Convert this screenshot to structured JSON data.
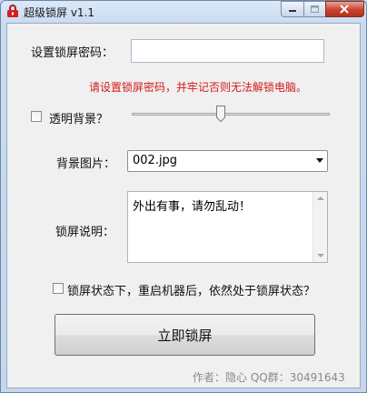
{
  "window": {
    "title": "超级锁屏 v1.1"
  },
  "form": {
    "password_label": "设置锁屏密码：",
    "password_value": "",
    "warning": "请设置锁屏密码，并牢记否则无法解锁电脑。",
    "transparent_label": "透明背景？",
    "transparent_checked": false,
    "bg_image_label": "背景图片：",
    "bg_image_selected": "002.jpg",
    "note_label": "锁屏说明：",
    "note_text": "外出有事，请勿乱动！",
    "persist_label": "锁屏状态下，重启机器后，依然处于锁屏状态？",
    "persist_checked": false,
    "lock_button": "立即锁屏"
  },
  "footer": {
    "credit": "作者：隐心  QQ群：30491643"
  },
  "colors": {
    "warning": "#d31a1a",
    "close": "#c7432d"
  }
}
